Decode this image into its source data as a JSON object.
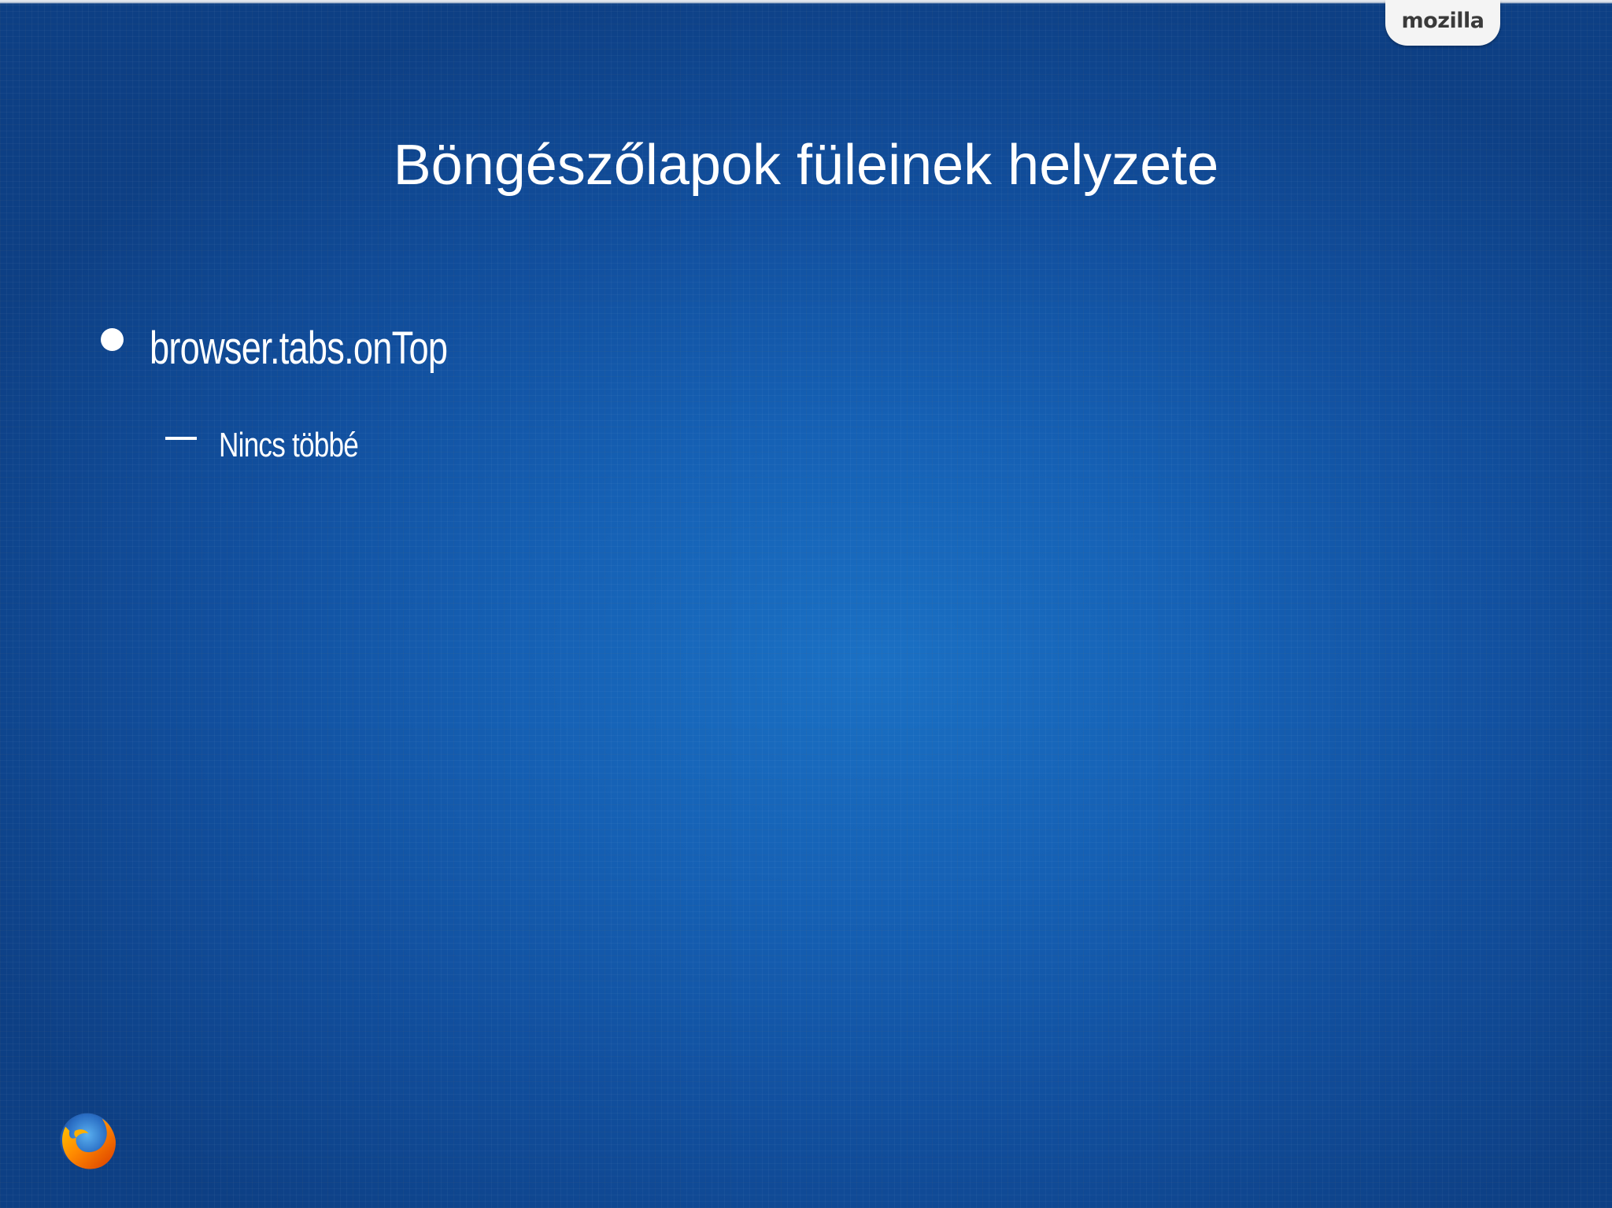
{
  "slide": {
    "title": "Böngészőlapok füleinek helyzete",
    "bullets": [
      {
        "text": "browser.tabs.onTop",
        "subitems": [
          {
            "text": "Nincs többé"
          }
        ]
      }
    ]
  },
  "branding": {
    "wordmark": "mozilla",
    "logo_icon": "firefox-logo-icon"
  },
  "colors": {
    "background_center": "#1a70c4",
    "background_edge": "#0d3f84",
    "text": "#ffffff",
    "tab_background": "#f4f4f4",
    "firefox_orange": "#e66000"
  }
}
